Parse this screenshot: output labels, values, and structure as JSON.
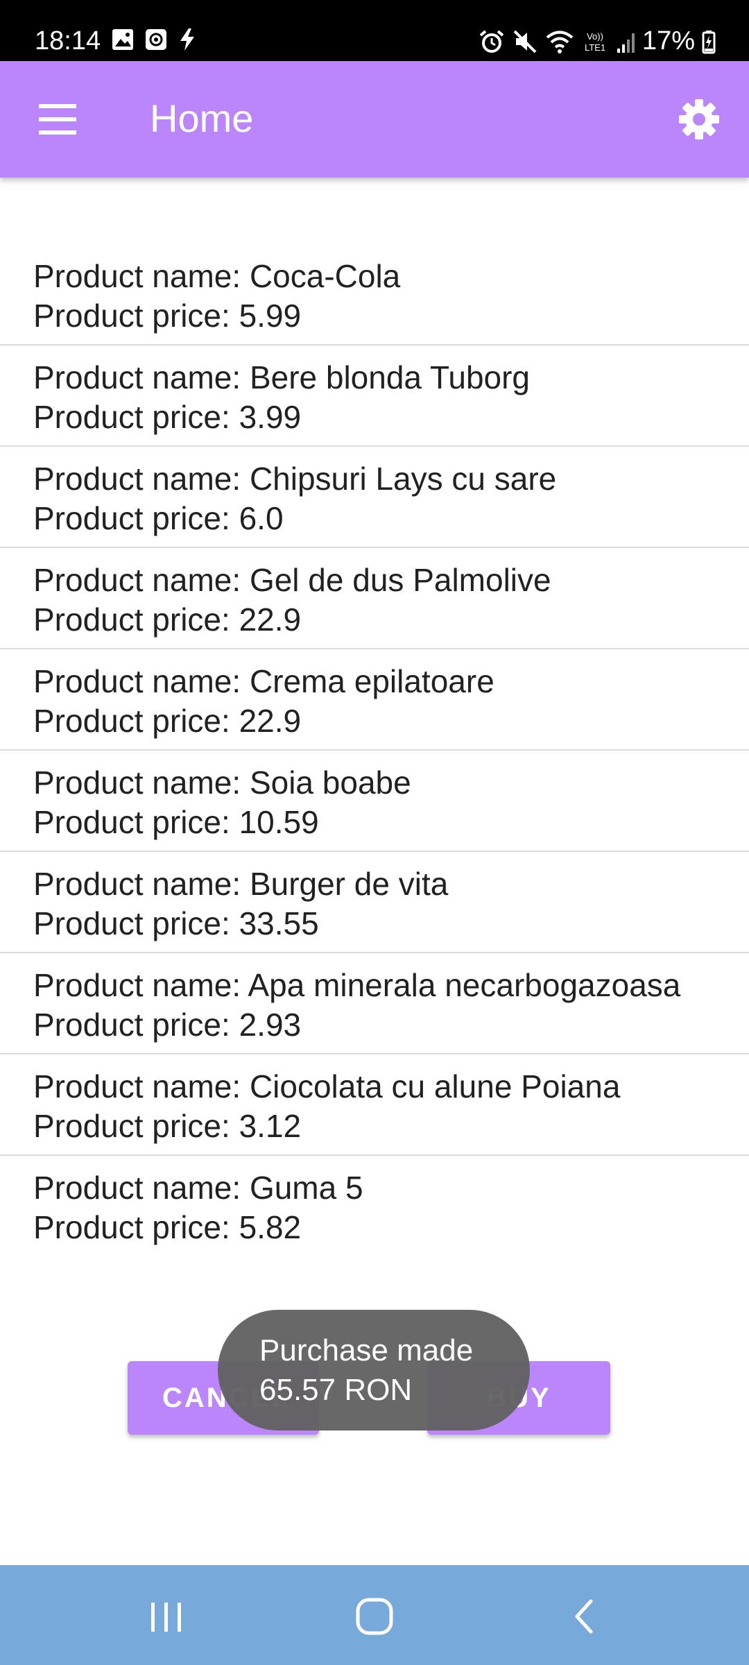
{
  "status_bar": {
    "time": "18:14",
    "battery": "17%",
    "left_icons": [
      "image-icon",
      "clock-app-icon",
      "flash-icon"
    ],
    "right_icons": [
      "alarm-icon",
      "mute-icon",
      "wifi-icon",
      "lte-icon",
      "signal-icon",
      "battery-icon"
    ]
  },
  "app_bar": {
    "title": "Home",
    "menu_icon": "menu-icon",
    "settings_icon": "gear-icon",
    "color": "#bb86fc"
  },
  "products": [
    {
      "name": "Product name: Coca-Cola",
      "price": "Product price: 5.99"
    },
    {
      "name": "Product name: Bere blonda Tuborg",
      "price": "Product price: 3.99"
    },
    {
      "name": "Product name: Chipsuri Lays cu sare",
      "price": "Product price: 6.0"
    },
    {
      "name": "Product name: Gel de dus Palmolive",
      "price": "Product price: 22.9"
    },
    {
      "name": "Product name: Crema epilatoare",
      "price": "Product price: 22.9"
    },
    {
      "name": "Product name: Soia boabe",
      "price": "Product price: 10.59"
    },
    {
      "name": "Product name: Burger de vita",
      "price": "Product price: 33.55"
    },
    {
      "name": "Product name: Apa minerala necarbogazoasa",
      "price": "Product price: 2.93"
    },
    {
      "name": "Product name: Ciocolata cu alune Poiana",
      "price": "Product price: 3.12"
    },
    {
      "name": "Product name: Guma 5",
      "price": "Product price: 5.82"
    }
  ],
  "buttons": {
    "cancel": "CANCEL",
    "buy": "BUY"
  },
  "toast": {
    "line1": "Purchase made",
    "line2": "65.57 RON"
  },
  "nav_bar": {
    "icons": [
      "recent-apps-icon",
      "home-icon",
      "back-icon"
    ],
    "color": "#77a9da"
  }
}
